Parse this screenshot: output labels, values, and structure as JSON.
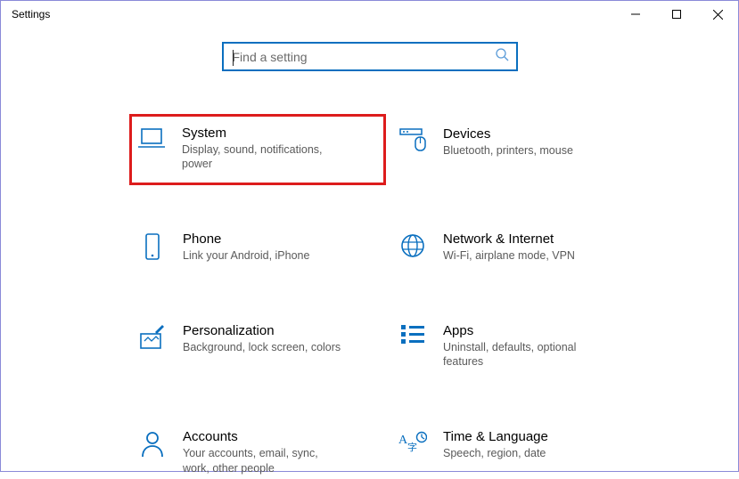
{
  "window": {
    "title": "Settings"
  },
  "search": {
    "placeholder": "Find a setting"
  },
  "tiles": [
    {
      "title": "System",
      "desc": "Display, sound, notifications, power"
    },
    {
      "title": "Devices",
      "desc": "Bluetooth, printers, mouse"
    },
    {
      "title": "Phone",
      "desc": "Link your Android, iPhone"
    },
    {
      "title": "Network & Internet",
      "desc": "Wi-Fi, airplane mode, VPN"
    },
    {
      "title": "Personalization",
      "desc": "Background, lock screen, colors"
    },
    {
      "title": "Apps",
      "desc": "Uninstall, defaults, optional features"
    },
    {
      "title": "Accounts",
      "desc": "Your accounts, email, sync, work, other people"
    },
    {
      "title": "Time & Language",
      "desc": "Speech, region, date"
    }
  ]
}
